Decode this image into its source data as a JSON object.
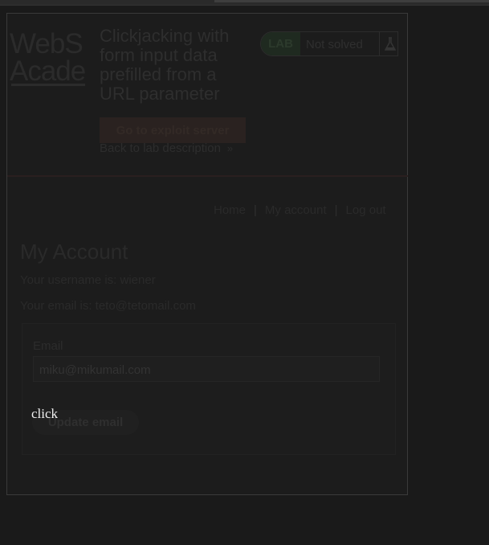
{
  "logo": {
    "line1": "WebS",
    "line2": "Acade"
  },
  "lab": {
    "title": "Clickjacking with form input data prefilled from a URL parameter",
    "exploit_button": "Go to exploit server",
    "back_link": "Back to lab description",
    "back_chevron": "»",
    "badge": "LAB",
    "status": "Not solved"
  },
  "nav": {
    "home": "Home",
    "account": "My account",
    "logout": "Log out",
    "separator": "|"
  },
  "account": {
    "heading": "My Account",
    "username_text": "Your username is: wiener",
    "email_text": "Your email is: teto@tetomail.com"
  },
  "form": {
    "email_label": "Email",
    "email_value": "miku@mikumail.com",
    "update_button": "Update email"
  },
  "decoy": {
    "text": "click"
  }
}
